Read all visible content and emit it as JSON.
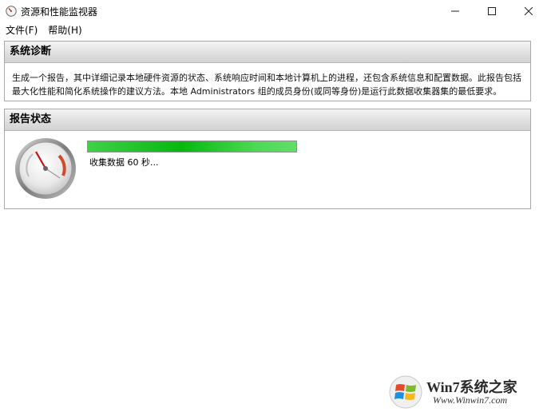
{
  "window": {
    "title": "资源和性能监视器"
  },
  "menu": {
    "file": "文件(F)",
    "help": "帮助(H)"
  },
  "diagnosis": {
    "title": "系统诊断",
    "description": "生成一个报告，其中详细记录本地硬件资源的状态、系统响应时间和本地计算机上的进程，还包含系统信息和配置数据。此报告包括最大化性能和简化系统操作的建议方法。本地 Administrators 组的成员身份(或同等身份)是运行此数据收集器集的最低要求。"
  },
  "report_status": {
    "title": "报告状态",
    "progress_text": "收集数据 60 秒...",
    "progress_fraction": 1.0
  },
  "watermark": {
    "brand": "Win7系统之家",
    "url": "Www.Winwin7.com"
  },
  "colors": {
    "progress_green": "#06b80e",
    "panel_border": "#a9a9a9",
    "gauge_needle": "#cc1111"
  },
  "icons": [
    "perfmon-app-icon",
    "minimize-icon",
    "maximize-icon",
    "close-icon",
    "gauge-icon",
    "windows-logo-icon"
  ]
}
